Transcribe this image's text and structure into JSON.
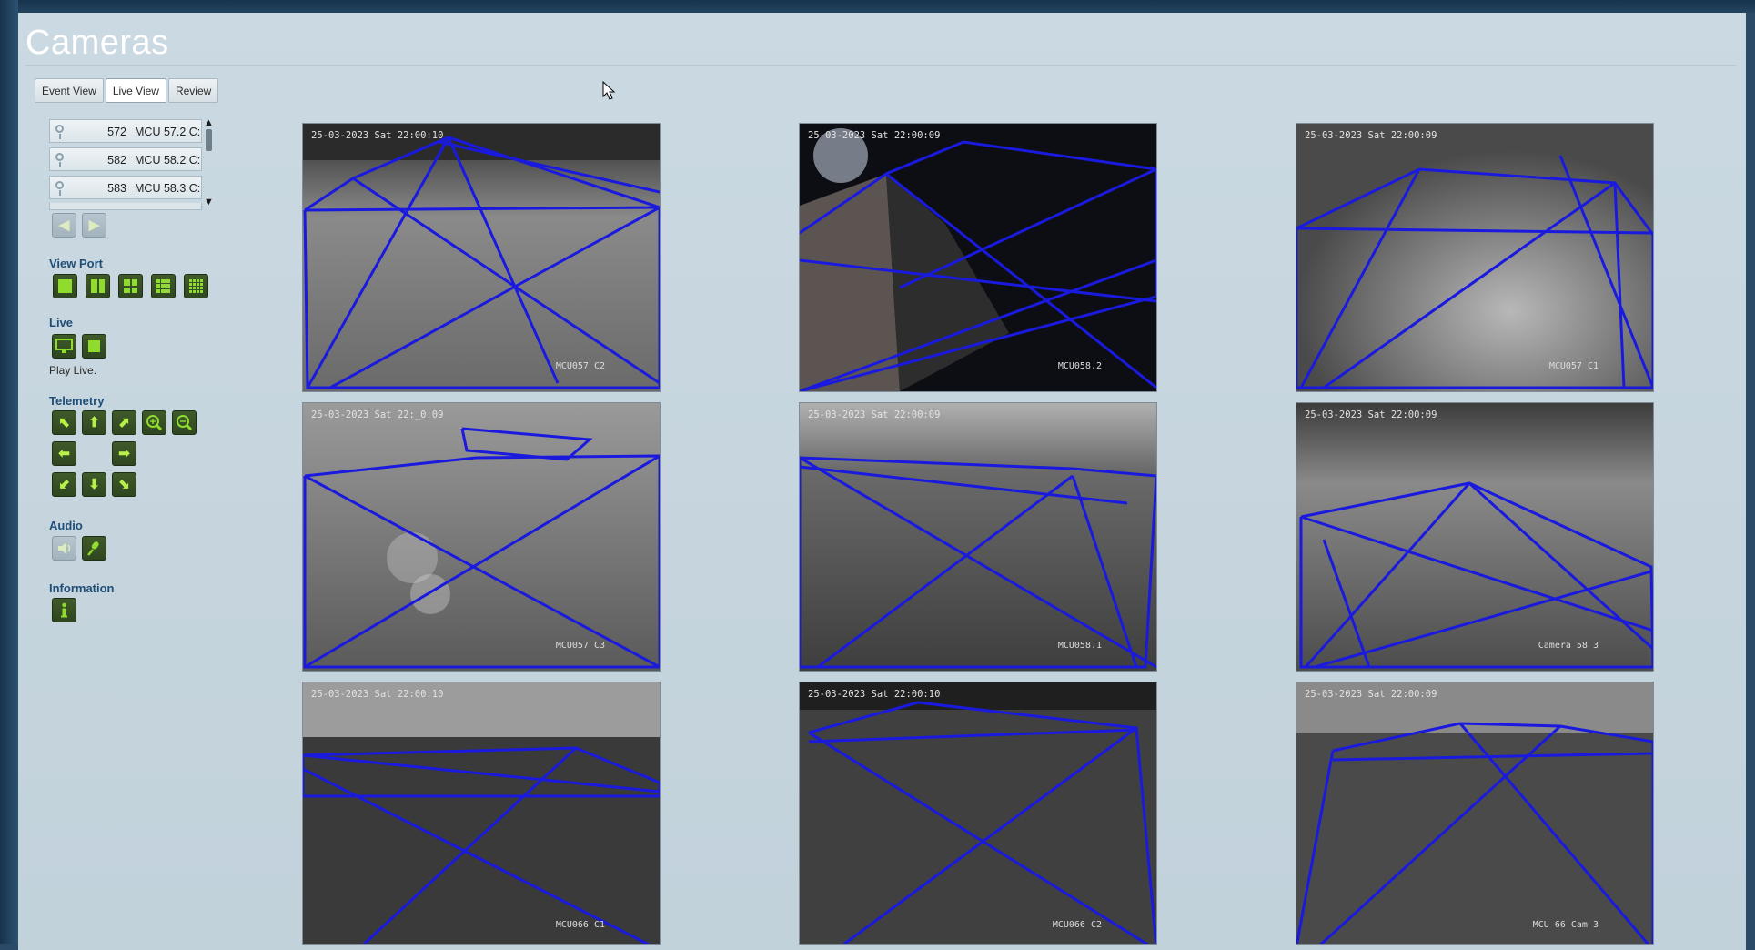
{
  "window": {
    "title": "Cameras"
  },
  "tabs": [
    {
      "label": "Event View"
    },
    {
      "label": "Live View"
    },
    {
      "label": "Review"
    }
  ],
  "camera_list": [
    {
      "id": "572",
      "name": "MCU 57.2 C:"
    },
    {
      "id": "582",
      "name": "MCU 58.2 C:"
    },
    {
      "id": "583",
      "name": "MCU 58.3 C:"
    }
  ],
  "sections": {
    "view_port": "View Port",
    "live": "Live",
    "play_live": "Play Live.",
    "telemetry": "Telemetry",
    "audio": "Audio",
    "information": "Information"
  },
  "icons": {
    "prev": "arrow-left-icon",
    "next": "arrow-right-icon",
    "monitor": "monitor-icon",
    "stop": "stop-icon",
    "zoom_in": "zoom-in-icon",
    "zoom_out": "zoom-out-icon",
    "speaker": "speaker-icon",
    "microphone": "microphone-icon",
    "info": "info-icon"
  },
  "colors": {
    "accent_green": "#8fdc2e",
    "zone_line": "#1a1adf",
    "section_heading": "#1f4e78"
  },
  "feeds": [
    {
      "timestamp": "25-03-2023 Sat 22:00:10",
      "label": "MCU057 C2"
    },
    {
      "timestamp": "25-03-2023 Sat 22:00:09",
      "label": "MCU058.2"
    },
    {
      "timestamp": "25-03-2023 Sat 22:00:09",
      "label": "MCU057 C1"
    },
    {
      "timestamp": "25-03-2023 Sat 22:_0:09",
      "label": "MCU057 C3"
    },
    {
      "timestamp": "25-03-2023 Sat 22:00:09",
      "label": "MCU058.1"
    },
    {
      "timestamp": "25-03-2023 Sat 22:00:09",
      "label": "Camera 58 3"
    },
    {
      "timestamp": "25-03-2023 Sat 22:00:10",
      "label": "MCU066 C1"
    },
    {
      "timestamp": "25-03-2023 Sat 22:00:10",
      "label": "MCU066 C2"
    },
    {
      "timestamp": "25-03-2023 Sat 22:00:09",
      "label": "MCU 66 Cam 3"
    }
  ]
}
